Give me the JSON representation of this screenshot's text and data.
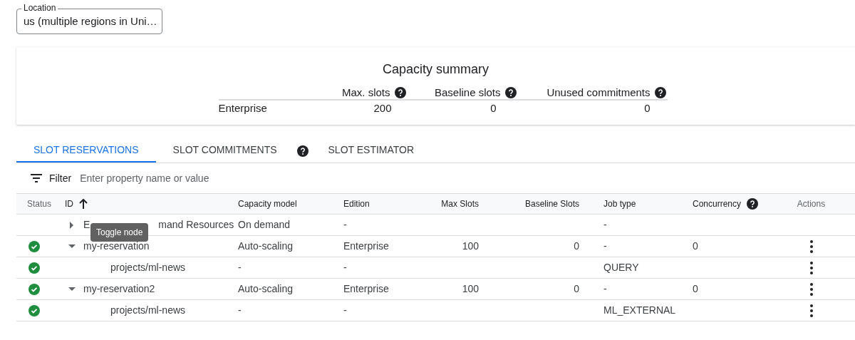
{
  "location": {
    "label": "Location",
    "value": "us (multiple regions in Uni…"
  },
  "summary": {
    "title": "Capacity summary",
    "columns": [
      "Max. slots",
      "Baseline slots",
      "Unused commitments"
    ],
    "rows": [
      {
        "edition": "Enterprise",
        "values": [
          "200",
          "0",
          "0"
        ]
      }
    ]
  },
  "tabs": [
    {
      "label": "SLOT RESERVATIONS",
      "selected": true,
      "help": false
    },
    {
      "label": "SLOT COMMITMENTS",
      "selected": false,
      "help": true
    },
    {
      "label": "SLOT ESTIMATOR",
      "selected": false,
      "help": false
    }
  ],
  "filter": {
    "label": "Filter",
    "placeholder": "Enter property name or value"
  },
  "table": {
    "columns": [
      {
        "label": "Status",
        "help": false,
        "sorted": false
      },
      {
        "label": "ID",
        "help": false,
        "sorted": true
      },
      {
        "label": "Capacity model",
        "help": false,
        "sorted": false
      },
      {
        "label": "Edition",
        "help": false,
        "sorted": false
      },
      {
        "label": "Max Slots",
        "help": false,
        "sorted": false
      },
      {
        "label": "Baseline Slots",
        "help": false,
        "sorted": false
      },
      {
        "label": "Job type",
        "help": false,
        "sorted": false
      },
      {
        "label": "Concurrency",
        "help": true,
        "sorted": false
      },
      {
        "label": "Actions",
        "help": false,
        "sorted": false
      }
    ],
    "rows": [
      {
        "status_ok": false,
        "expanded": false,
        "id_parts": [
          "E",
          "mand Resources"
        ],
        "capacity_model": "On demand",
        "edition": "-",
        "job_type": "-",
        "actions": false,
        "children": []
      },
      {
        "status_ok": true,
        "expanded": true,
        "id_parts": [
          "my-reservation"
        ],
        "capacity_model": "Auto-scaling",
        "edition": "Enterprise",
        "max_slots": "100",
        "baseline_slots": "0",
        "job_type": "-",
        "concurrency": "0",
        "actions": true,
        "children": [
          {
            "status_ok": true,
            "id_parts": [
              "projects/ml-news"
            ],
            "capacity_model": "-",
            "edition": "-",
            "job_type": "QUERY",
            "actions": true
          }
        ]
      },
      {
        "status_ok": true,
        "expanded": true,
        "id_parts": [
          "my-reservation2"
        ],
        "capacity_model": "Auto-scaling",
        "edition": "Enterprise",
        "max_slots": "100",
        "baseline_slots": "0",
        "job_type": "-",
        "concurrency": "0",
        "actions": true,
        "children": [
          {
            "status_ok": true,
            "id_parts": [
              "projects/ml-news"
            ],
            "capacity_model": "-",
            "edition": "-",
            "job_type": "ML_EXTERNAL",
            "actions": true
          }
        ]
      }
    ]
  },
  "tooltip": {
    "text": "Toggle node"
  }
}
